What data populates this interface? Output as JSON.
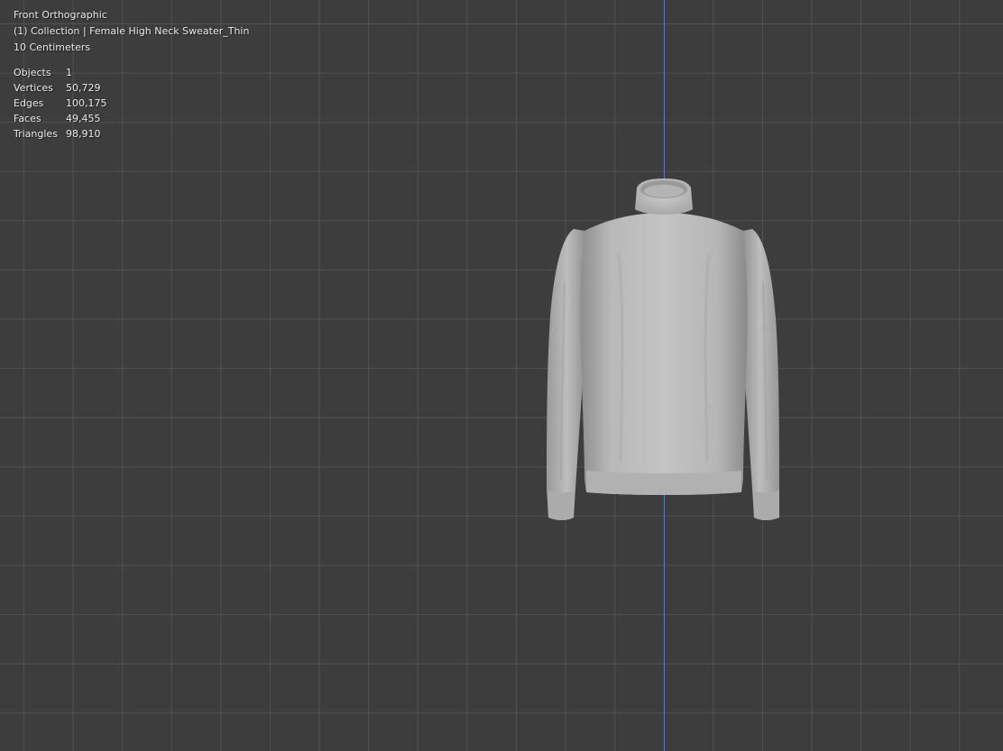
{
  "viewport": {
    "view_name": "Front Orthographic",
    "collection_line": "(1) Collection | Female High Neck Sweater_Thin",
    "grid_scale": "10 Centimeters",
    "stats": [
      {
        "label": "Objects",
        "value": "1"
      },
      {
        "label": "Vertices",
        "value": "50,729"
      },
      {
        "label": "Edges",
        "value": "100,175"
      },
      {
        "label": "Faces",
        "value": "49,455"
      },
      {
        "label": "Triangles",
        "value": "98,910"
      }
    ],
    "colors": {
      "background": "#3d3d3d",
      "grid_line": "#4b4b4b",
      "z_axis": "#4a7bc4",
      "mesh": "#b9b9b9"
    }
  }
}
